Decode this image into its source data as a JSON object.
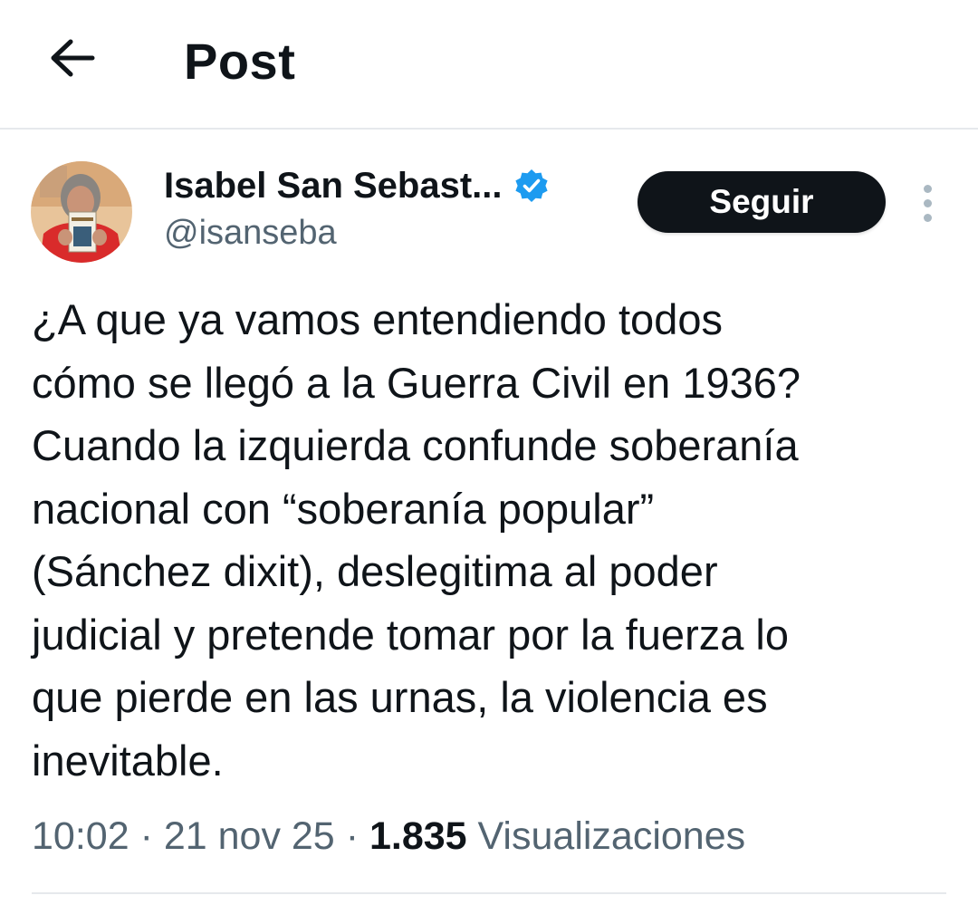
{
  "header": {
    "title": "Post",
    "back_icon": "arrow-left-icon"
  },
  "author": {
    "display_name": "Isabel San Sebast...",
    "handle": "@isanseba",
    "verified": true,
    "verified_color": "#1d9bf0",
    "avatar": "author-avatar-photo"
  },
  "actions": {
    "follow_label": "Seguir",
    "more_icon": "more-vertical-icon"
  },
  "post": {
    "text": "¿A que ya vamos entendiendo todos\ncómo se llegó a la Guerra Civil en 1936?\nCuando la izquierda confunde soberanía\nnacional con “soberanía popular”\n(Sánchez dixit), deslegitima al poder\njudicial y pretende tomar por la fuerza lo\nque pierde en las urnas, la violencia es\ninevitable.",
    "time": "10:02",
    "separator": "·",
    "date": "21 nov 25",
    "views_count": "1.835",
    "views_label": "Visualizaciones"
  },
  "colors": {
    "text_primary": "#0f1419",
    "text_secondary": "#536471",
    "divider": "#e6e9ec",
    "button_bg": "#0f1419",
    "button_text": "#ffffff"
  }
}
